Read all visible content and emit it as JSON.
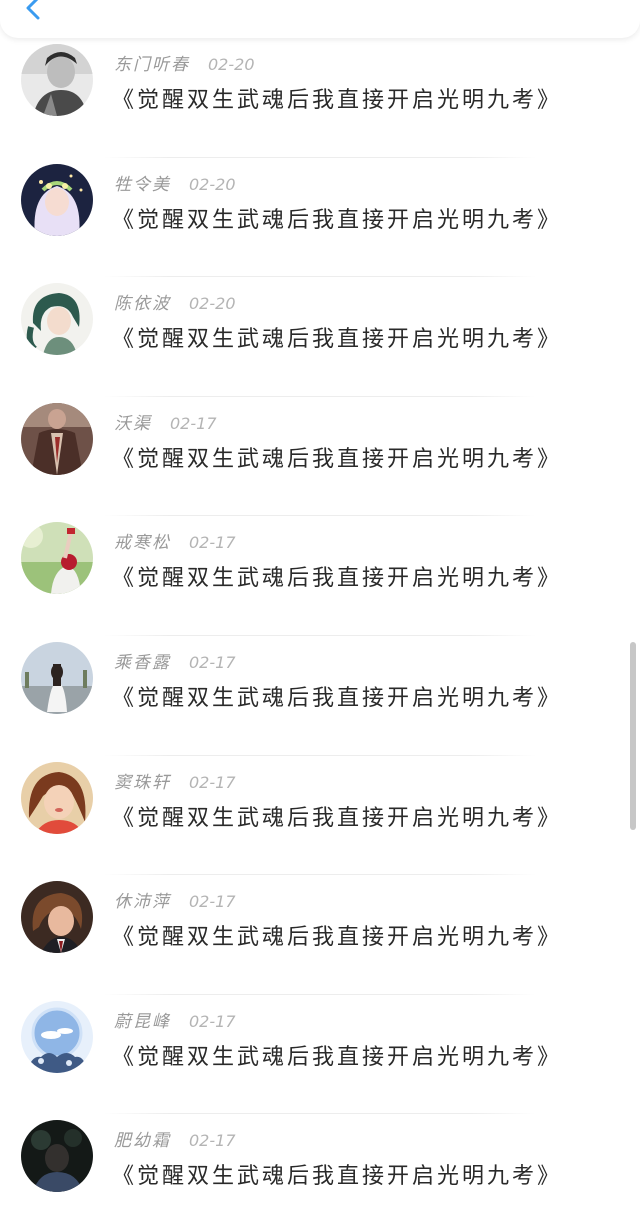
{
  "header": {
    "back_icon": "chevron-left-icon",
    "accent": "#3a9bf0"
  },
  "comments": [
    {
      "user": "东门听春",
      "date": "02-20",
      "text": "《觉醒双生武魂后我直接开启光明九考》",
      "avatar": "avatar-photo"
    },
    {
      "user": "牲令美",
      "date": "02-20",
      "text": "《觉醒双生武魂后我直接开启光明九考》",
      "avatar": "avatar-photo"
    },
    {
      "user": "陈依波",
      "date": "02-20",
      "text": "《觉醒双生武魂后我直接开启光明九考》",
      "avatar": "avatar-photo"
    },
    {
      "user": "沃渠",
      "date": "02-17",
      "text": "《觉醒双生武魂后我直接开启光明九考》",
      "avatar": "avatar-photo"
    },
    {
      "user": "戒寒松",
      "date": "02-17",
      "text": "《觉醒双生武魂后我直接开启光明九考》",
      "avatar": "avatar-photo"
    },
    {
      "user": "乘香露",
      "date": "02-17",
      "text": "《觉醒双生武魂后我直接开启光明九考》",
      "avatar": "avatar-photo"
    },
    {
      "user": "窦珠轩",
      "date": "02-17",
      "text": "《觉醒双生武魂后我直接开启光明九考》",
      "avatar": "avatar-photo"
    },
    {
      "user": "休沛萍",
      "date": "02-17",
      "text": "《觉醒双生武魂后我直接开启光明九考》",
      "avatar": "avatar-photo"
    },
    {
      "user": "蔚昆峰",
      "date": "02-17",
      "text": "《觉醒双生武魂后我直接开启光明九考》",
      "avatar": "avatar-photo"
    },
    {
      "user": "肥幼霜",
      "date": "02-17",
      "text": "《觉醒双生武魂后我直接开启光明九考》",
      "avatar": "avatar-photo"
    }
  ]
}
